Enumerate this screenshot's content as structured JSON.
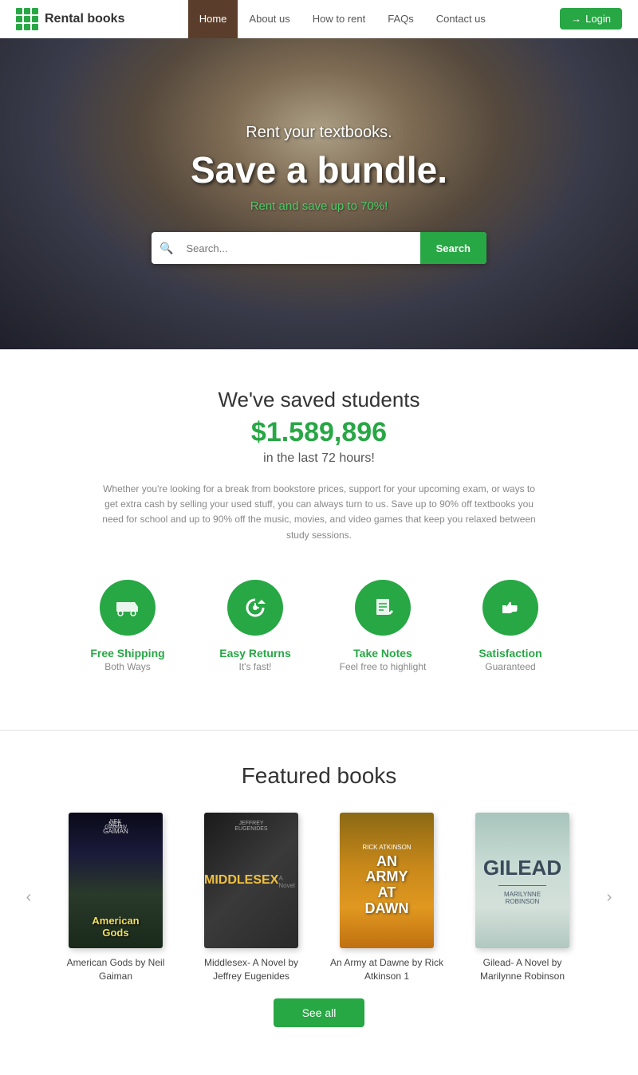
{
  "brand": {
    "name": "Rental books"
  },
  "navbar": {
    "items": [
      {
        "id": "home",
        "label": "Home",
        "active": true
      },
      {
        "id": "about",
        "label": "About us",
        "active": false
      },
      {
        "id": "howto",
        "label": "How to rent",
        "active": false
      },
      {
        "id": "faqs",
        "label": "FAQs",
        "active": false
      },
      {
        "id": "contact",
        "label": "Contact us",
        "active": false
      }
    ],
    "login_label": "Login"
  },
  "hero": {
    "subtitle": "Rent your textbooks.",
    "title": "Save a bundle.",
    "cta_link": "Rent and save up to 70%!",
    "search_placeholder": "Search...",
    "search_button": "Search"
  },
  "stats": {
    "title": "We've saved students",
    "amount": "$1.589,896",
    "subtitle": "in the last 72 hours!",
    "description": "Whether you're looking for a break from bookstore prices, support for your upcoming exam, or ways to get extra cash by selling your used stuff, you can always turn to us. Save up to 90% off textbooks you need for school and up to 90% off the music, movies, and video games that keep you relaxed between study sessions."
  },
  "features": [
    {
      "id": "free-shipping",
      "icon": "🚚",
      "label": "Free Shipping",
      "sublabel": "Both Ways"
    },
    {
      "id": "easy-returns",
      "icon": "↩",
      "label": "Easy Returns",
      "sublabel": "It's fast!"
    },
    {
      "id": "take-notes",
      "icon": "✏",
      "label": "Take Notes",
      "sublabel": "Feel free to highlight"
    },
    {
      "id": "satisfaction",
      "icon": "👍",
      "label": "Satisfaction",
      "sublabel": "Guaranteed"
    }
  ],
  "featured": {
    "title": "Featured books",
    "books": [
      {
        "id": "american-gods",
        "title": "American Gods\nby Neil Gaiman",
        "author": "Neil Gaiman"
      },
      {
        "id": "middlesex",
        "title": "Middlesex- A Novel\nby Jeffrey Eugenides",
        "author": "Jeffrey Eugenides"
      },
      {
        "id": "army-at-dawn",
        "title": "An Army at Dawne\nby Rick Atkinson 1",
        "author": "Rick Atkinson"
      },
      {
        "id": "gilead",
        "title": "Gilead- A Novel\nby Marilynne Robinson",
        "author": "Marilynne Robinson"
      }
    ],
    "see_all_label": "See all"
  }
}
